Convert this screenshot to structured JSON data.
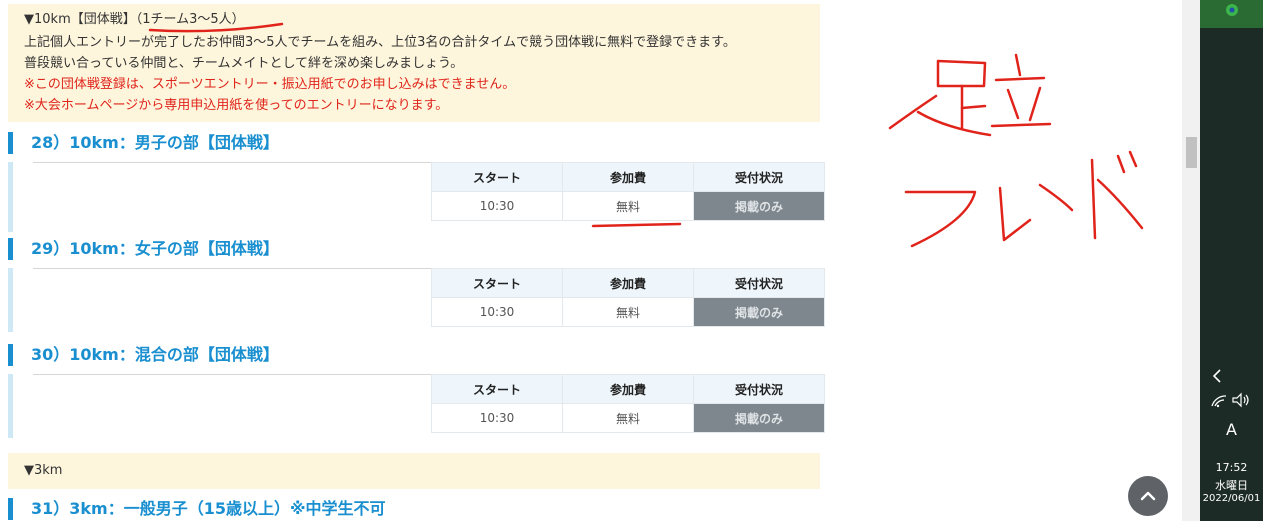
{
  "notice": {
    "heading": "▼10km【団体戦】（1チーム3〜5人）",
    "line1": "上記個人エントリーが完了したお仲間3〜5人でチームを組み、上位3名の合計タイムで競う団体戦に無料で登録できます。",
    "line2": "普段競い合っている仲間と、チームメイトとして絆を深め楽しみましょう。",
    "warning1": "※この団体戦登録は、スポーツエントリー・振込用紙でのお申し込みはできません。",
    "warning2": "※大会ホームページから専用申込用紙を使ってのエントリーになります。"
  },
  "table_headers": {
    "start": "スタート",
    "fee": "参加費",
    "status": "受付状況"
  },
  "races": [
    {
      "title": "28）10km：男子の部【団体戦】",
      "start": "10:30",
      "fee": "無料",
      "status": "掲載のみ"
    },
    {
      "title": "29）10km：女子の部【団体戦】",
      "start": "10:30",
      "fee": "無料",
      "status": "掲載のみ"
    },
    {
      "title": "30）10km：混合の部【団体戦】",
      "start": "10:30",
      "fee": "無料",
      "status": "掲載のみ"
    }
  ],
  "section_3km": "▼3km",
  "race31_title": "31）3km：一般男子（15歳以上）※中学生不可",
  "annotation": {
    "strokes": "handwritten red ink",
    "color": "#e0241b"
  },
  "taskbar": {
    "ime": "A",
    "time": "17:52",
    "day": "水曜日",
    "date": "2022/06/01"
  },
  "scroll_top_icon": "chevron-up-icon"
}
